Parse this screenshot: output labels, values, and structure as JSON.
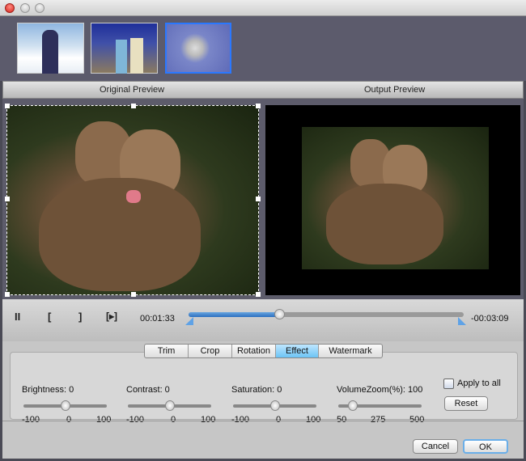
{
  "thumbnails": [
    {
      "name": "skier",
      "selected": false
    },
    {
      "name": "wedding",
      "selected": false
    },
    {
      "name": "kitten",
      "selected": true
    }
  ],
  "preview": {
    "original_label": "Original Preview",
    "output_label": "Output Preview"
  },
  "playback": {
    "current_time": "00:01:33",
    "remaining_time": "-00:03:09",
    "progress_percent": 33,
    "pause": "II",
    "mark_in": "[",
    "mark_out": "]",
    "play_segment": "[▸]"
  },
  "tabs": [
    {
      "label": "Trim"
    },
    {
      "label": "Crop"
    },
    {
      "label": "Rotation"
    },
    {
      "label": "Effect",
      "selected": true
    },
    {
      "label": "Watermark"
    }
  ],
  "effect": {
    "brightness": {
      "label": "Brightness: 0",
      "min": "-100",
      "mid": "0",
      "max": "100",
      "value": 0
    },
    "contrast": {
      "label": "Contrast: 0",
      "min": "-100",
      "mid": "0",
      "max": "100",
      "value": 0
    },
    "saturation": {
      "label": "Saturation: 0",
      "min": "-100",
      "mid": "0",
      "max": "100",
      "value": 0
    },
    "volume": {
      "label": "VolumeZoom(%): 100",
      "min": "50",
      "mid": "275",
      "max": "500",
      "value": 100
    },
    "apply_all": "Apply to all",
    "reset": "Reset"
  },
  "buttons": {
    "cancel": "Cancel",
    "ok": "OK"
  }
}
